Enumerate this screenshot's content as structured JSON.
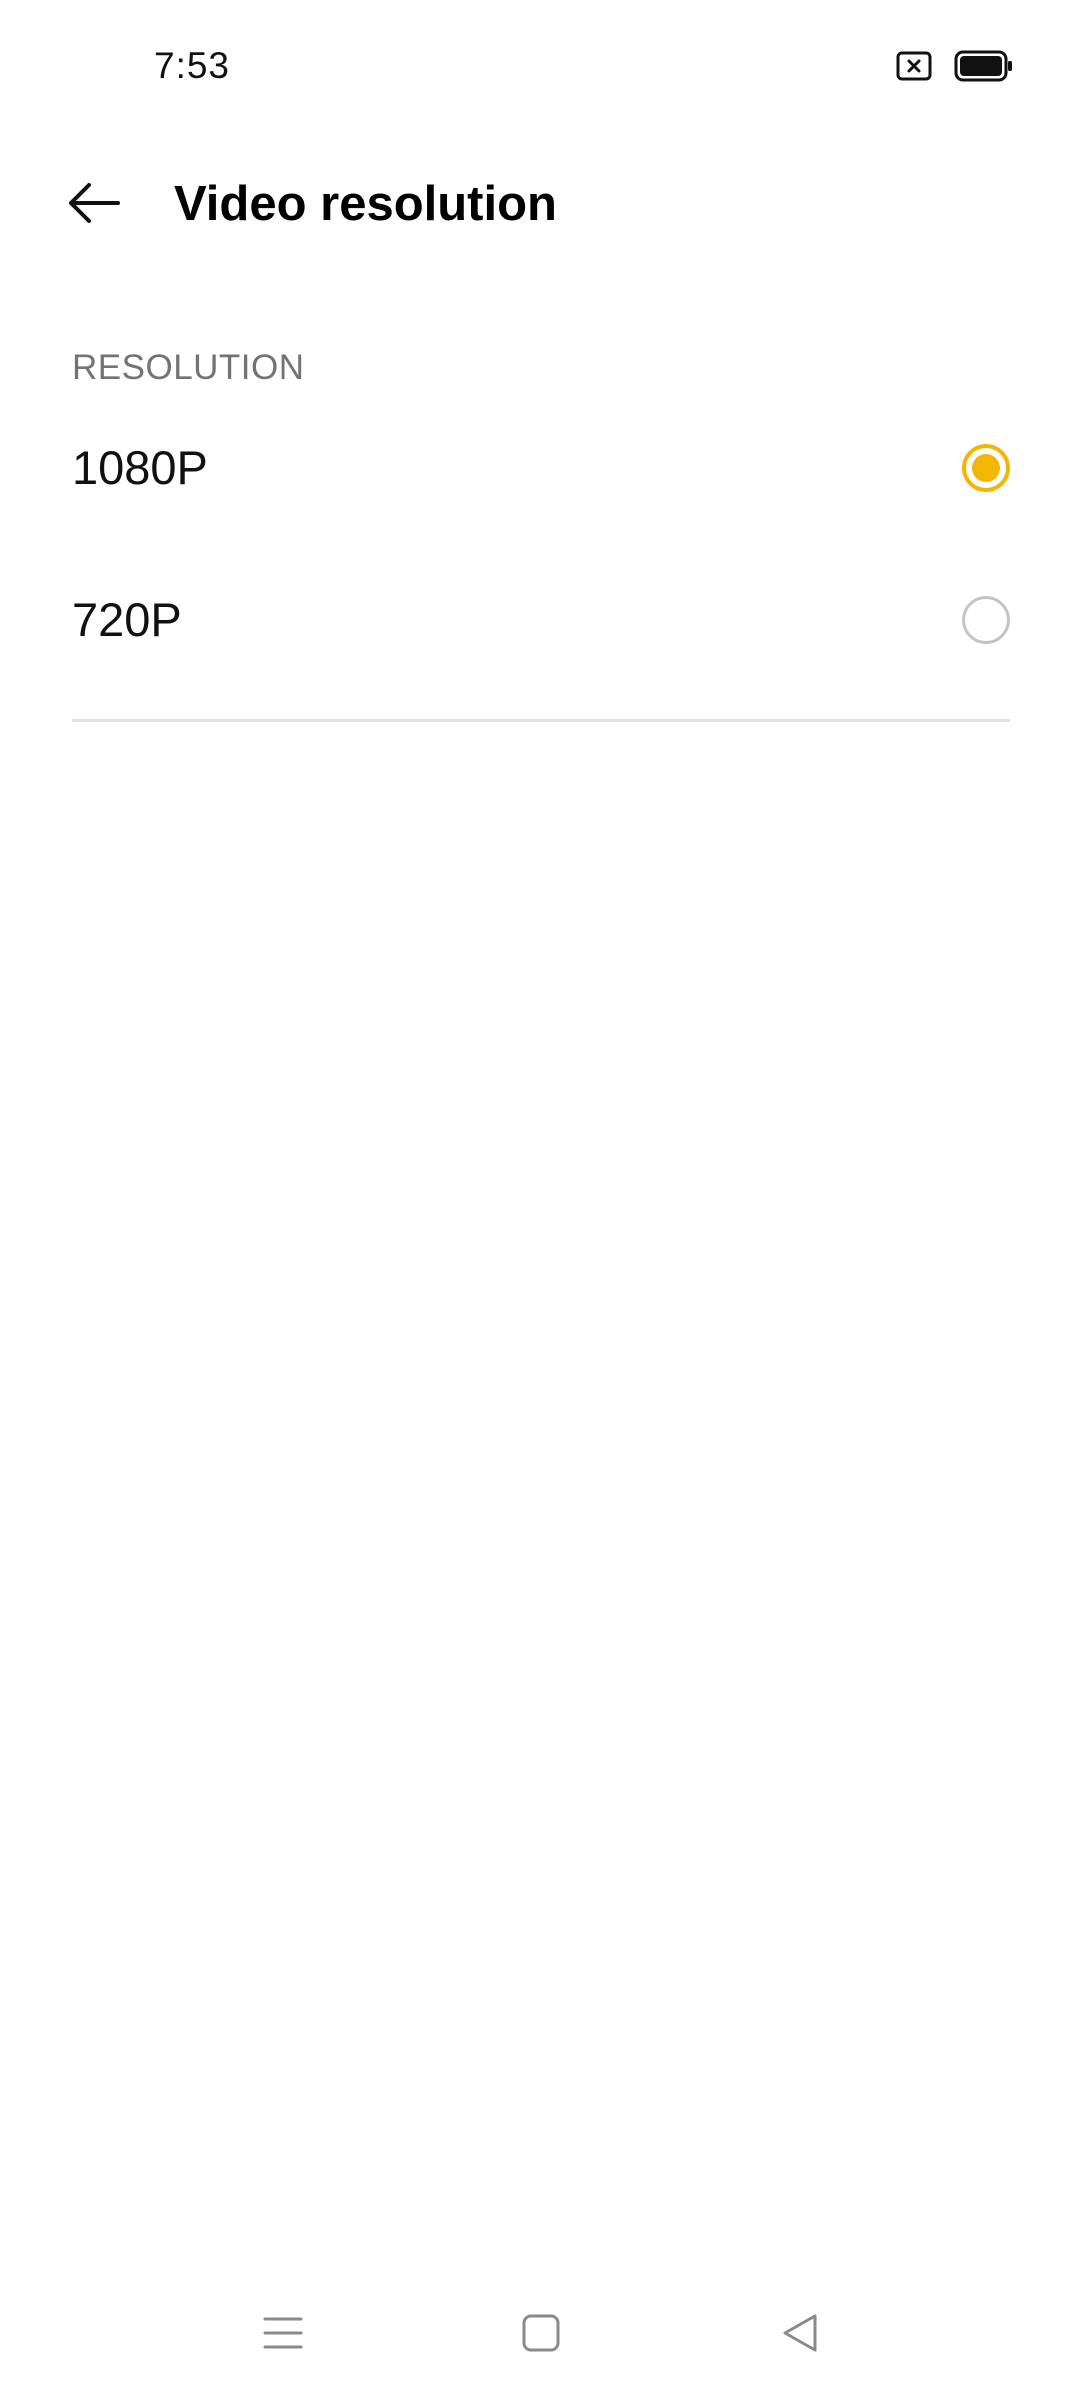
{
  "status_bar": {
    "time": "7:53",
    "icons": [
      "notification-x-icon",
      "battery-full-icon"
    ]
  },
  "app_bar": {
    "back_icon": "arrow-left-icon",
    "title": "Video resolution"
  },
  "section": {
    "header": "RESOLUTION",
    "options": [
      {
        "label": "1080P",
        "selected": true
      },
      {
        "label": "720P",
        "selected": false
      }
    ]
  },
  "nav_bar": {
    "icons": [
      "menu-icon",
      "home-icon",
      "back-triangle-icon"
    ]
  },
  "colors": {
    "accent": "#F2B705",
    "section_header": "#737373",
    "divider": "#e3e3e3",
    "radio_unchecked": "#c4c4c4"
  }
}
